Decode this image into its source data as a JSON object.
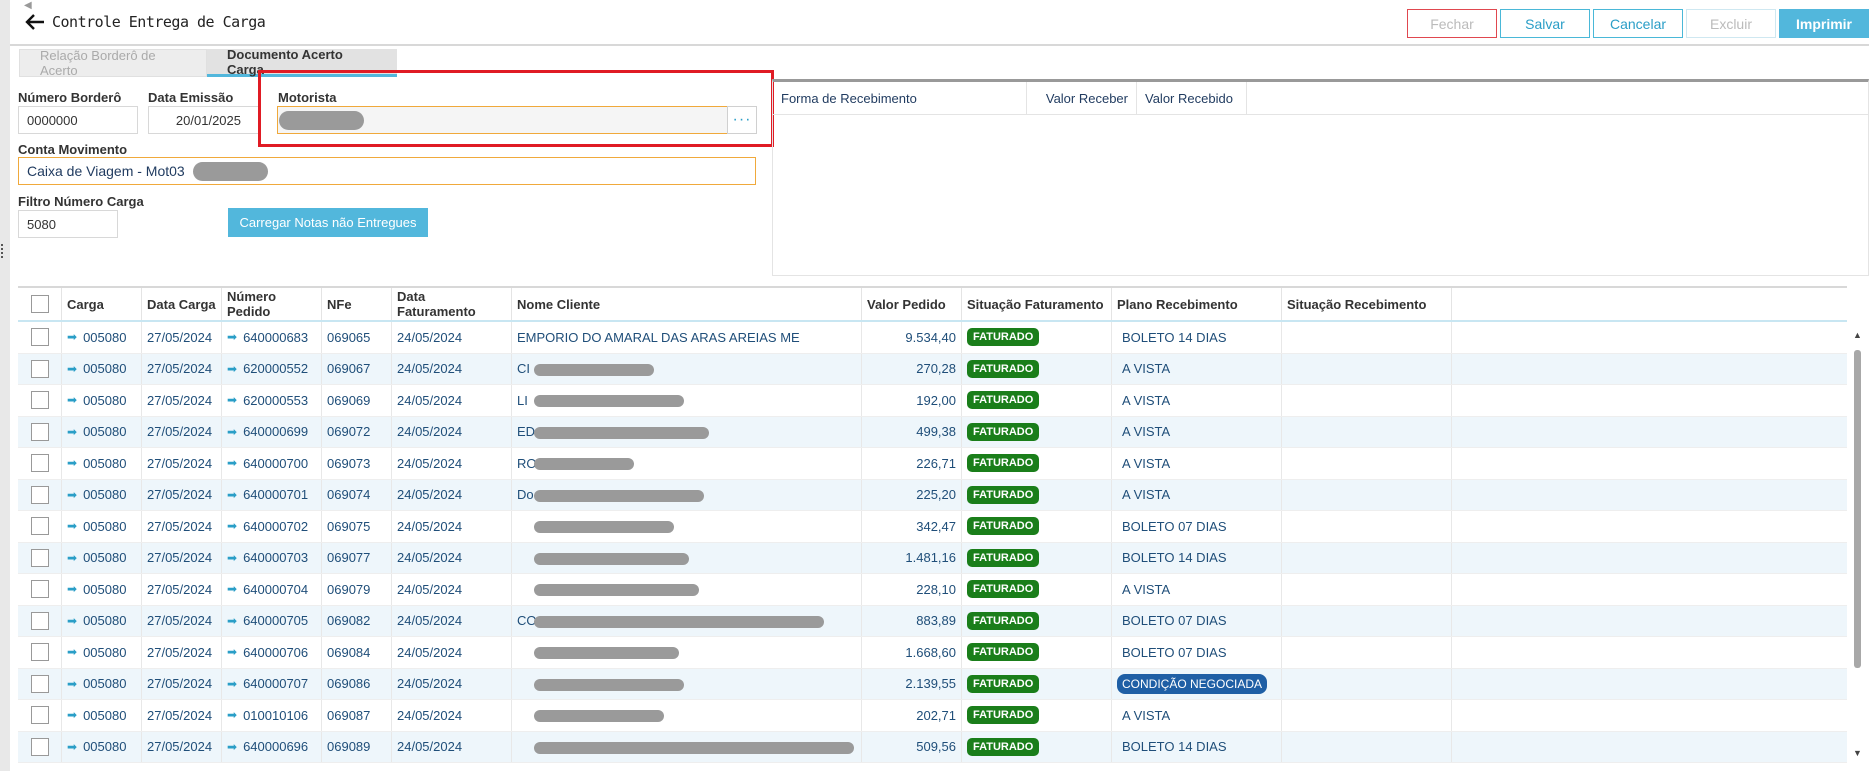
{
  "header": {
    "title": "Controle Entrega de Carga",
    "buttons": {
      "fechar": "Fechar",
      "salvar": "Salvar",
      "cancelar": "Cancelar",
      "excluir": "Excluir",
      "imprimir": "Imprimir"
    }
  },
  "tabs": [
    {
      "label": "Relação Borderô de Acerto",
      "active": false
    },
    {
      "label": "Documento Acerto Carga",
      "active": true
    }
  ],
  "form": {
    "numero_bordero": {
      "label": "Número Borderô",
      "value": "0000000"
    },
    "data_emissao": {
      "label": "Data Emissão",
      "value": "20/01/2025"
    },
    "motorista": {
      "label": "Motorista",
      "value": ""
    },
    "conta_movimento": {
      "label": "Conta Movimento",
      "value": "Caixa de Viagem - Mot03"
    },
    "filtro_numero_carga": {
      "label": "Filtro Número Carga",
      "value": "5080"
    },
    "load_button": "Carregar Notas não Entregues"
  },
  "payment_panel": {
    "columns": [
      "Forma de Recebimento",
      "Valor Receber",
      "Valor Recebido"
    ]
  },
  "grid": {
    "columns": [
      "Carga",
      "Data Carga",
      "Número Pedido",
      "NFe",
      "Data Faturamento",
      "Nome Cliente",
      "Valor Pedido",
      "Situação Faturamento",
      "Plano Recebimento",
      "Situação Recebimento"
    ],
    "rows": [
      {
        "carga": "005080",
        "data_carga": "27/05/2024",
        "pedido": "640000683",
        "nfe": "069065",
        "data_fat": "24/05/2024",
        "cliente": "EMPORIO DO AMARAL DAS ARAS AREIAS ME",
        "valor": "9.534,40",
        "situacao": "FATURADO",
        "plano": "BOLETO 14 DIAS"
      },
      {
        "carga": "005080",
        "data_carga": "27/05/2024",
        "pedido": "620000552",
        "nfe": "069067",
        "data_fat": "24/05/2024",
        "cliente": "CI",
        "valor": "270,28",
        "situacao": "FATURADO",
        "plano": "A VISTA"
      },
      {
        "carga": "005080",
        "data_carga": "27/05/2024",
        "pedido": "620000553",
        "nfe": "069069",
        "data_fat": "24/05/2024",
        "cliente": "LI",
        "valor": "192,00",
        "situacao": "FATURADO",
        "plano": "A VISTA"
      },
      {
        "carga": "005080",
        "data_carga": "27/05/2024",
        "pedido": "640000699",
        "nfe": "069072",
        "data_fat": "24/05/2024",
        "cliente": "ED",
        "valor": "499,38",
        "situacao": "FATURADO",
        "plano": "A VISTA"
      },
      {
        "carga": "005080",
        "data_carga": "27/05/2024",
        "pedido": "640000700",
        "nfe": "069073",
        "data_fat": "24/05/2024",
        "cliente": "RO",
        "valor": "226,71",
        "situacao": "FATURADO",
        "plano": "A VISTA"
      },
      {
        "carga": "005080",
        "data_carga": "27/05/2024",
        "pedido": "640000701",
        "nfe": "069074",
        "data_fat": "24/05/2024",
        "cliente": "Do",
        "valor": "225,20",
        "situacao": "FATURADO",
        "plano": "A VISTA"
      },
      {
        "carga": "005080",
        "data_carga": "27/05/2024",
        "pedido": "640000702",
        "nfe": "069075",
        "data_fat": "24/05/2024",
        "cliente": "",
        "valor": "342,47",
        "situacao": "FATURADO",
        "plano": "BOLETO 07 DIAS"
      },
      {
        "carga": "005080",
        "data_carga": "27/05/2024",
        "pedido": "640000703",
        "nfe": "069077",
        "data_fat": "24/05/2024",
        "cliente": "",
        "valor": "1.481,16",
        "situacao": "FATURADO",
        "plano": "BOLETO 14 DIAS"
      },
      {
        "carga": "005080",
        "data_carga": "27/05/2024",
        "pedido": "640000704",
        "nfe": "069079",
        "data_fat": "24/05/2024",
        "cliente": "",
        "valor": "228,10",
        "situacao": "FATURADO",
        "plano": "A VISTA"
      },
      {
        "carga": "005080",
        "data_carga": "27/05/2024",
        "pedido": "640000705",
        "nfe": "069082",
        "data_fat": "24/05/2024",
        "cliente": "CO",
        "valor": "883,89",
        "situacao": "FATURADO",
        "plano": "BOLETO 07 DIAS"
      },
      {
        "carga": "005080",
        "data_carga": "27/05/2024",
        "pedido": "640000706",
        "nfe": "069084",
        "data_fat": "24/05/2024",
        "cliente": "",
        "valor": "1.668,60",
        "situacao": "FATURADO",
        "plano": "BOLETO 07 DIAS"
      },
      {
        "carga": "005080",
        "data_carga": "27/05/2024",
        "pedido": "640000707",
        "nfe": "069086",
        "data_fat": "24/05/2024",
        "cliente": "",
        "valor": "2.139,55",
        "situacao": "FATURADO",
        "plano": "CONDIÇÃO NEGOCIADA",
        "plano_highlight": true
      },
      {
        "carga": "005080",
        "data_carga": "27/05/2024",
        "pedido": "010010106",
        "nfe": "069087",
        "data_fat": "24/05/2024",
        "cliente": "",
        "valor": "202,71",
        "situacao": "FATURADO",
        "plano": "A VISTA"
      },
      {
        "carga": "005080",
        "data_carga": "27/05/2024",
        "pedido": "640000696",
        "nfe": "069089",
        "data_fat": "24/05/2024",
        "cliente": "",
        "valor": "509,56",
        "situacao": "FATURADO",
        "plano": "BOLETO 14 DIAS"
      }
    ]
  },
  "colors": {
    "accent": "#52b7dc",
    "badge_green": "#1a7e1a",
    "badge_blue": "#1f5fa5",
    "highlight_red": "#e01b24"
  }
}
